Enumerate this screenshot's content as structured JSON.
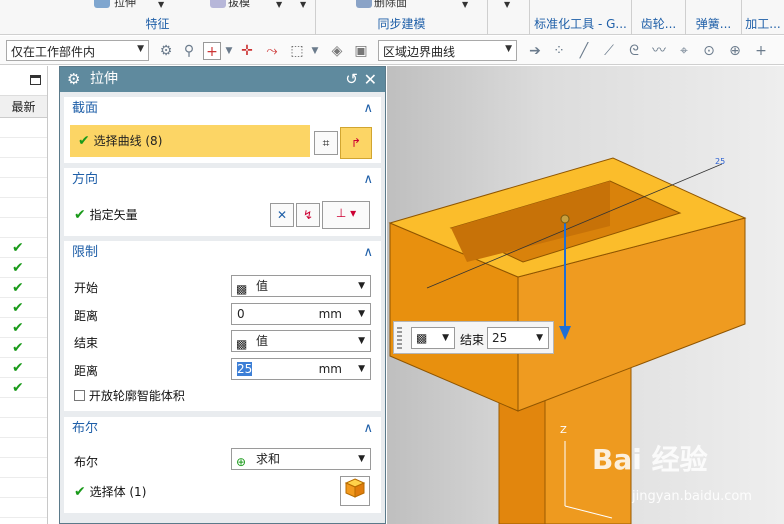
{
  "ribbon": {
    "cut_label_1": "拉伸",
    "cut_label_2": "拔模",
    "cut_label_3": "删除面",
    "groups": [
      {
        "label": "特征"
      },
      {
        "label": "同步建模"
      },
      {
        "label": "标准化工具 - G..."
      },
      {
        "label": "齿轮..."
      },
      {
        "label": "弹簧..."
      },
      {
        "label": "加工..."
      }
    ]
  },
  "toolbar": {
    "scope_select": "仅在工作部件内",
    "curve_rule_select": "区域边界曲线"
  },
  "part_navigator": {
    "column_header": "最新",
    "check_glyph": "✔",
    "checks": [
      true,
      true,
      true,
      true,
      true,
      true,
      true,
      true
    ]
  },
  "dialog": {
    "title": "拉伸",
    "section_curve": {
      "header": "截面",
      "select_curve": "选择曲线 (8)"
    },
    "section_direction": {
      "header": "方向",
      "specify_vector": "指定矢量"
    },
    "section_limits": {
      "header": "限制",
      "start_label": "开始",
      "start_value": "值",
      "start_distance_label": "距离",
      "start_distance": "0",
      "start_unit": "mm",
      "end_label": "结束",
      "end_value": "值",
      "end_distance_label": "距离",
      "end_distance": "25",
      "end_unit": "mm",
      "open_profile_label": "开放轮廓智能体积"
    },
    "section_boolean": {
      "header": "布尔",
      "boolean_label": "布尔",
      "boolean_value": "求和",
      "select_body": "选择体 (1)"
    }
  },
  "floating_toolbar": {
    "end_label": "结束",
    "end_value": "25"
  },
  "viewport": {
    "axis_z": "Z",
    "dim_label": "25",
    "model_color": "#e8900e",
    "top_color": "#fbbd2b"
  },
  "watermark": {
    "brand": "Bai 经验",
    "url": "jingyan.baidu.com"
  },
  "colors": {
    "accent": "#1f5fa8",
    "title_bar": "#5f8a9e",
    "selection": "#fcd565",
    "check": "#1a9a1a"
  }
}
